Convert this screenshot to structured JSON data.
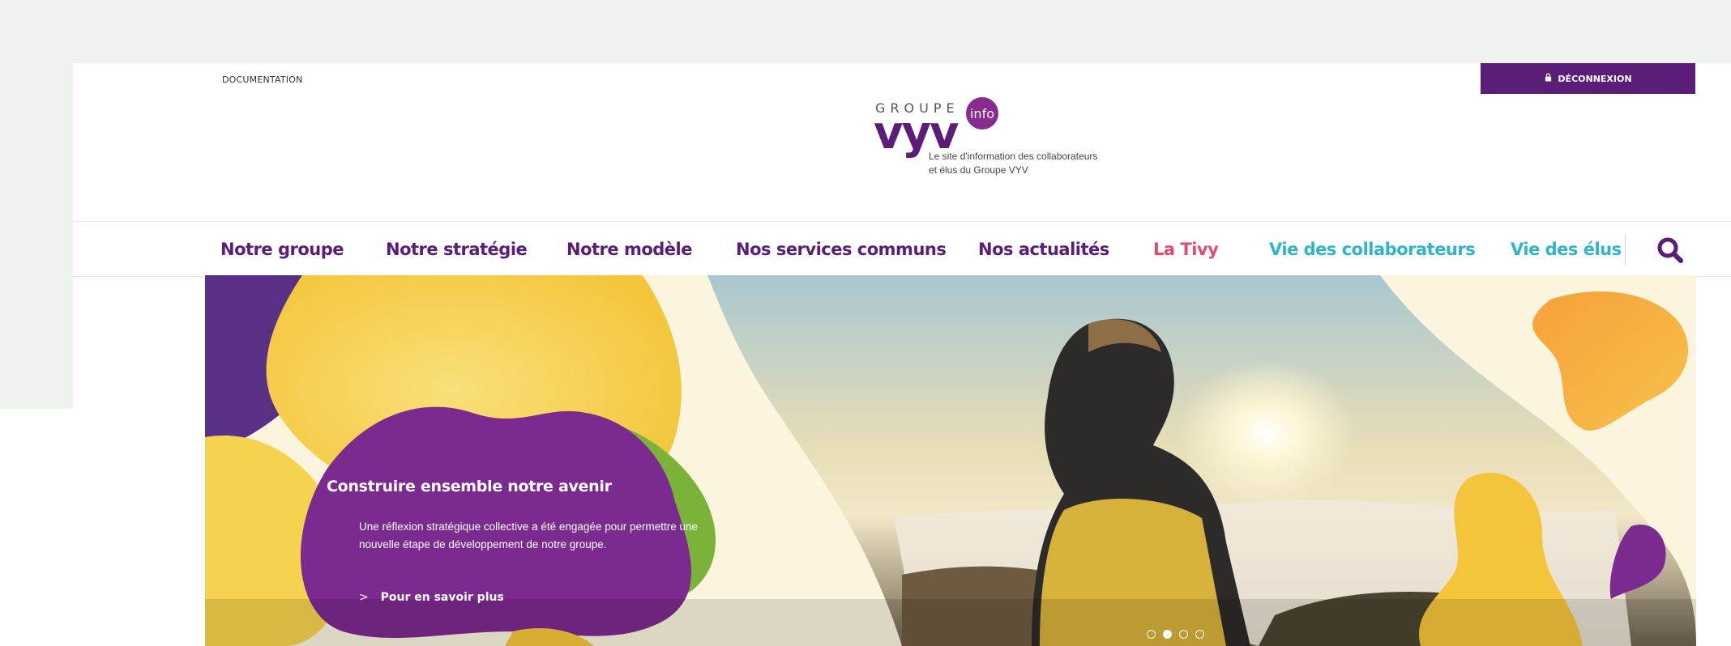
{
  "topbar": {
    "documentation_label": "DOCUMENTATION",
    "logout_label": "DÉCONNEXION",
    "logout_icon": "lock-icon"
  },
  "logo": {
    "groupe": "GROUPE",
    "vyv": "vyv",
    "info": "info",
    "tagline_line1": "Le site d'information des collaborateurs",
    "tagline_line2": "et élus du Groupe VYV"
  },
  "nav": {
    "items": [
      {
        "label": "Notre groupe",
        "color": "#5a1e78"
      },
      {
        "label": "Notre stratégie",
        "color": "#5a1e78"
      },
      {
        "label": "Notre modèle",
        "color": "#5a1e78"
      },
      {
        "label": "Nos services communs",
        "color": "#5a1e78"
      },
      {
        "label": "Nos actualités",
        "color": "#5a1e78"
      },
      {
        "label": "La Tivy",
        "color": "#e34b6b"
      },
      {
        "label": "Vie des collaborateurs",
        "color": "#2fb4c9"
      },
      {
        "label": "Vie des élus",
        "color": "#2fb4c9"
      }
    ],
    "search_icon": "search-icon"
  },
  "hero": {
    "title": "Construire ensemble notre avenir",
    "body": "Une réflexion stratégique collective a été engagée pour permettre une nouvelle étape de développement de notre groupe.",
    "cta": "Pour en savoir plus",
    "slides_total": 4,
    "active_slide": 2
  },
  "colors": {
    "brand_purple": "#5a1e78",
    "accent_pink": "#e34b6b",
    "accent_cyan": "#2fb4c9",
    "background_mint": "#eef3ed"
  }
}
